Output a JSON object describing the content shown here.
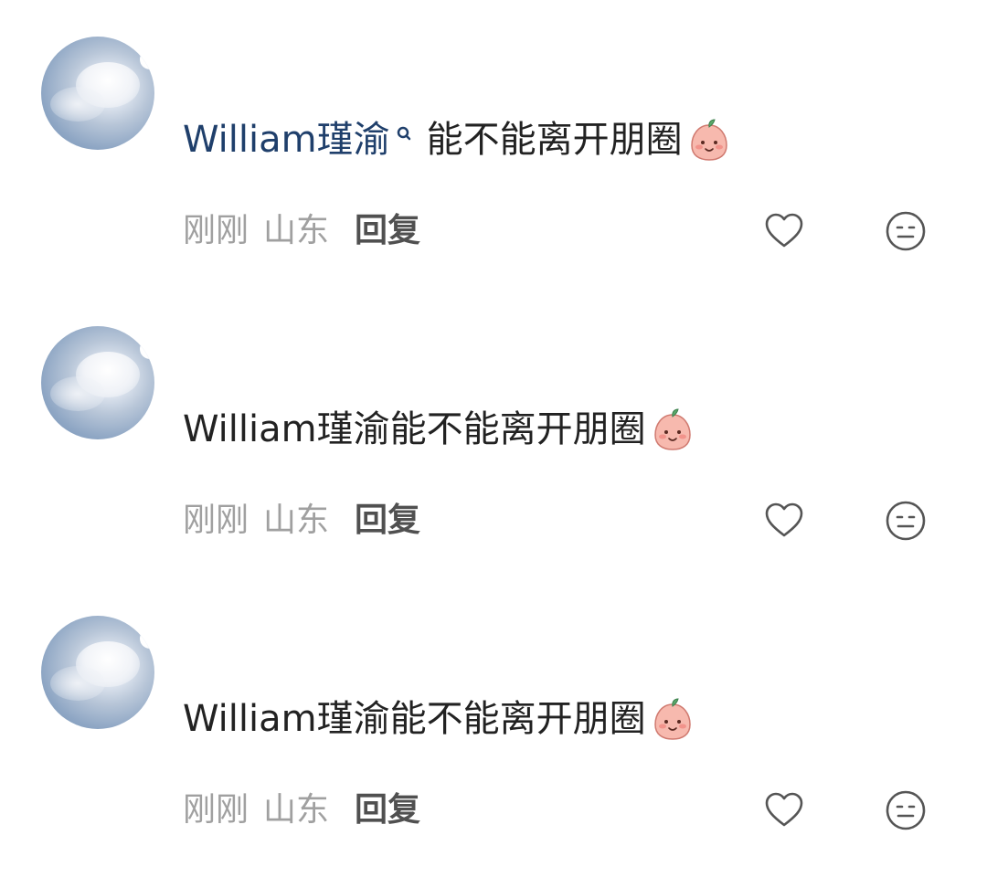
{
  "comments": [
    {
      "username": "William瑾渝",
      "has_search_icon": true,
      "text": "能不能离开朋圈",
      "emoji": "peach-face-emoji",
      "time": "刚刚",
      "location": "山东",
      "reply_label": "回复"
    },
    {
      "username": "",
      "has_search_icon": false,
      "text": "William瑾渝能不能离开朋圈",
      "emoji": "peach-face-emoji",
      "time": "刚刚",
      "location": "山东",
      "reply_label": "回复"
    },
    {
      "username": "",
      "has_search_icon": false,
      "text": "William瑾渝能不能离开朋圈",
      "emoji": "peach-face-emoji",
      "time": "刚刚",
      "location": "山东",
      "reply_label": "回复"
    }
  ],
  "icons": {
    "like": "heart-outline-icon",
    "dislike": "neutral-face-icon"
  },
  "colors": {
    "username": "#1f3f6b",
    "body_text": "#222222",
    "meta_text": "#a0a0a0",
    "reply_text": "#505050",
    "icon_stroke": "#555555"
  }
}
